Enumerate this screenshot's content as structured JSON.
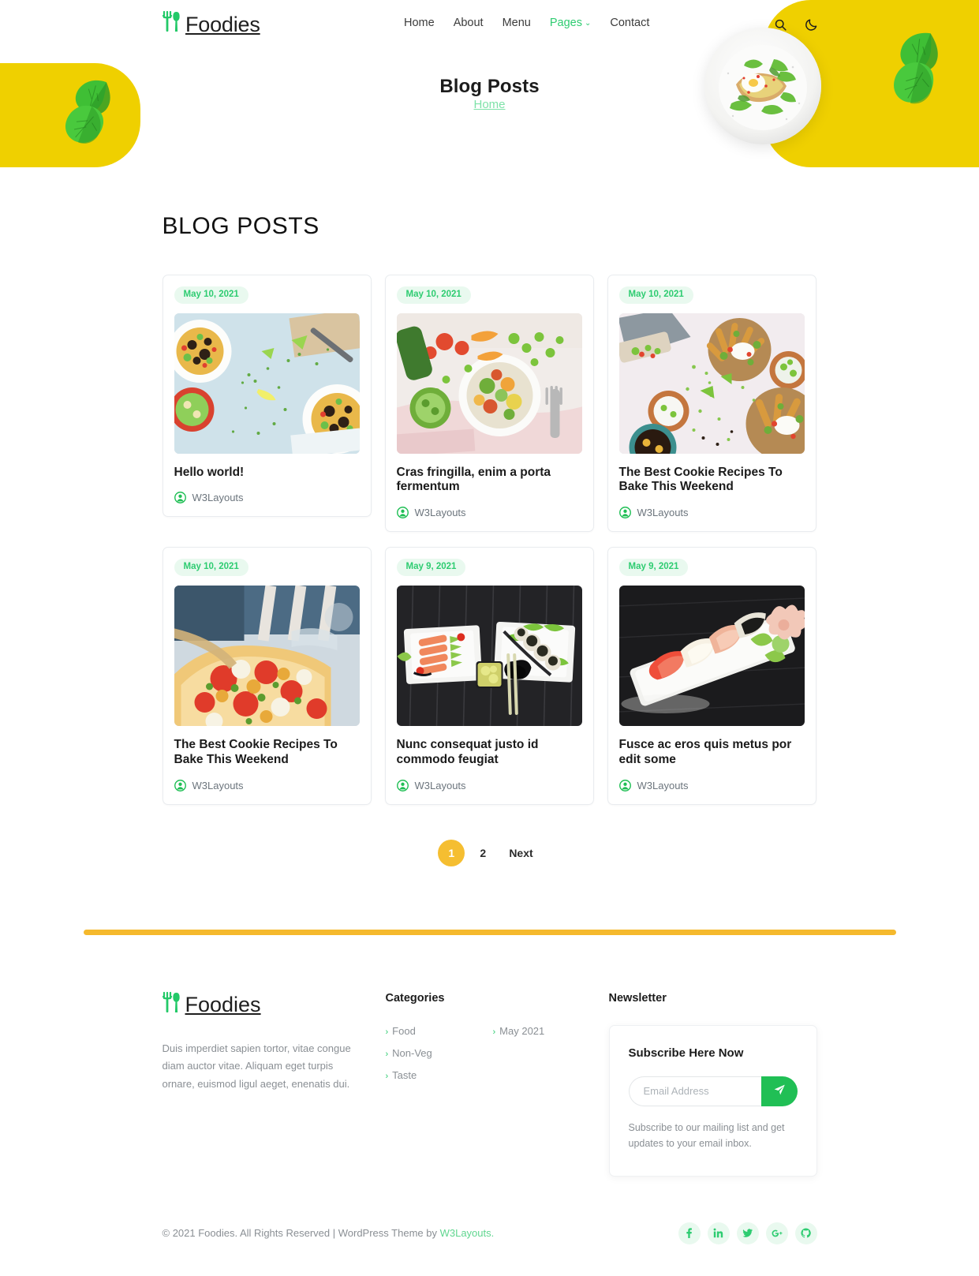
{
  "site": {
    "brand": "Foodies",
    "brand_icon": "cutlery-icon"
  },
  "header": {
    "nav": [
      {
        "label": "Home",
        "active": false
      },
      {
        "label": "About",
        "active": false
      },
      {
        "label": "Menu",
        "active": false
      },
      {
        "label": "Pages",
        "active": true,
        "has_dropdown": true
      },
      {
        "label": "Contact",
        "active": false
      }
    ],
    "search_icon": "search-icon",
    "theme_icon": "moon-icon",
    "accent_yellow": "#EFD000",
    "accent_green": "#2ecc71"
  },
  "hero": {
    "title": "Blog Posts",
    "breadcrumb": "Home"
  },
  "main": {
    "section_title": "BLOG POSTS",
    "posts": [
      {
        "date": "May 10, 2021",
        "title": "Hello world!",
        "author": "W3Layouts",
        "image": "salad-bowls-on-blue"
      },
      {
        "date": "May 10, 2021",
        "title": "Cras fringilla, enim a porta fermentum",
        "author": "W3Layouts",
        "image": "veggie-buddha-bowl"
      },
      {
        "date": "May 10, 2021",
        "title": "The Best Cookie Recipes To Bake This Weekend",
        "author": "W3Layouts",
        "image": "loaded-fries-pink"
      },
      {
        "date": "May 10, 2021",
        "title": "The Best Cookie Recipes To Bake This Weekend",
        "author": "W3Layouts",
        "image": "pizza-slice-hands"
      },
      {
        "date": "May 9, 2021",
        "title": "Nunc consequat justo id commodo feugiat",
        "author": "W3Layouts",
        "image": "sushi-two-plates-dark"
      },
      {
        "date": "May 9, 2021",
        "title": "Fusce ac eros quis metus por edit some",
        "author": "W3Layouts",
        "image": "nigiri-sushi-platter"
      }
    ],
    "pagination": {
      "current": "1",
      "pages": [
        "1",
        "2"
      ],
      "next_label": "Next"
    }
  },
  "footer": {
    "brand": "Foodies",
    "about": "Duis imperdiet sapien tortor, vitae congue diam auctor vitae. Aliquam eget turpis ornare, euismod ligul aeget, enenatis dui.",
    "categories_heading": "Categories",
    "categories_left": [
      "Food",
      "Non-Veg",
      "Taste"
    ],
    "categories_right": [
      "May 2021"
    ],
    "newsletter_heading": "Newsletter",
    "subscribe_title": "Subscribe Here Now",
    "email_placeholder": "Email Address",
    "email_value": "",
    "submit_icon": "send-icon",
    "newsletter_note": "Subscribe to our mailing list and get updates to your email inbox.",
    "copyright_prefix": "© 2021 Foodies. All Rights Reserved | WordPress Theme by ",
    "copyright_link": "W3Layouts.",
    "socials": [
      {
        "name": "facebook-icon",
        "glyph": "f"
      },
      {
        "name": "linkedin-icon",
        "glyph": "in"
      },
      {
        "name": "twitter-icon",
        "glyph": "t"
      },
      {
        "name": "google-plus-icon",
        "glyph": "G+"
      },
      {
        "name": "github-icon",
        "glyph": "gh"
      }
    ]
  }
}
